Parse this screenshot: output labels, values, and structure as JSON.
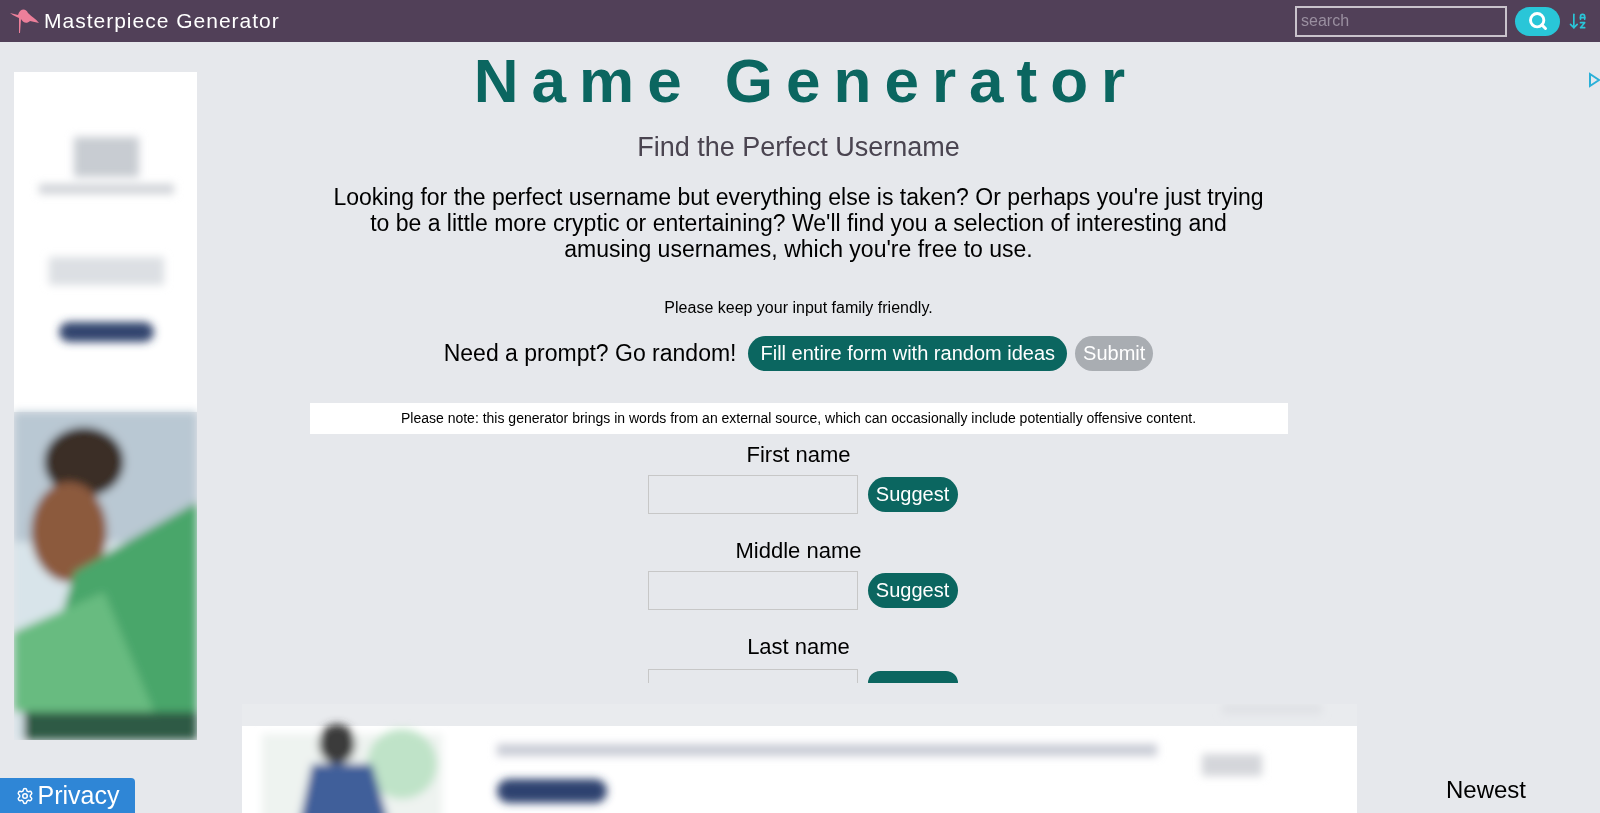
{
  "header": {
    "site_name": "Masterpiece Generator",
    "search": {
      "placeholder": "search"
    }
  },
  "main": {
    "title": "Name Generator",
    "subtitle": "Find the Perfect Username",
    "intro": "Looking for the perfect username but everything else is taken? Or perhaps you're just trying to be a little more cryptic or entertaining? We'll find you a selection of interesting and amusing usernames, which you're free to use.",
    "family_note": "Please keep your input family friendly.",
    "prompt": "Need a prompt? Go random!",
    "random_button": "Fill entire form with random ideas",
    "submit_button": {
      "label": "Submit",
      "disabled": true
    },
    "warning": "Please note: this generator brings in words from an external source, which can occasionally include potentially offensive content.",
    "fields": [
      {
        "label": "First name",
        "suggest": "Suggest"
      },
      {
        "label": "Middle name",
        "suggest": "Suggest"
      },
      {
        "label": "Last name"
      }
    ]
  },
  "sidebar_right": {
    "heading": "Newest"
  },
  "privacy_button": "Privacy"
}
